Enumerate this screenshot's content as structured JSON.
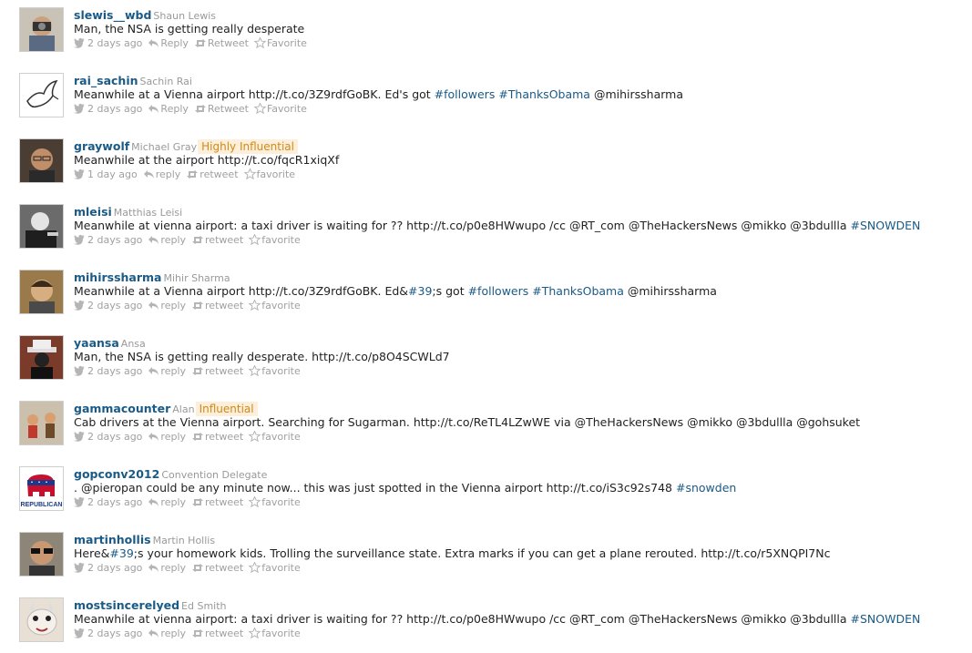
{
  "tweets": [
    {
      "handle": "slewis__wbd",
      "name": "Shaun Lewis",
      "badge": "",
      "parts": [
        {
          "t": "Man, the NSA is getting really desperate",
          "k": "plain"
        }
      ],
      "time": "2 days ago",
      "reply": "Reply",
      "retweet": "Retweet",
      "favorite": "Favorite",
      "avatar": "man-with-camera-avatar"
    },
    {
      "handle": "rai_sachin",
      "name": "Sachin Rai",
      "badge": "",
      "parts": [
        {
          "t": "Meanwhile at a Vienna airport http://t.co/3Z9rdfGoBK. Ed's got ",
          "k": "plain"
        },
        {
          "t": "#followers",
          "k": "hashtag"
        },
        {
          "t": " ",
          "k": "plain"
        },
        {
          "t": "#ThanksObama",
          "k": "hashtag"
        },
        {
          "t": " @mihirssharma",
          "k": "plain"
        }
      ],
      "time": "2 days ago",
      "reply": "Reply",
      "retweet": "Retweet",
      "favorite": "Favorite",
      "avatar": "dove-avatar"
    },
    {
      "handle": "graywolf",
      "name": "Michael Gray",
      "badge": "Highly Influential",
      "parts": [
        {
          "t": "Meanwhile at the airport http://t.co/fqcR1xiqXf",
          "k": "plain"
        }
      ],
      "time": "1 day ago",
      "reply": "reply",
      "retweet": "retweet",
      "favorite": "favorite",
      "avatar": "man-with-glasses-avatar"
    },
    {
      "handle": "mleisi",
      "name": "Matthias Leisi",
      "badge": "",
      "parts": [
        {
          "t": "Meanwhile at vienna airport: a taxi driver is waiting for ?? http://t.co/p0e8HWwupo /cc @RT_com @TheHackersNews @mikko @3bdullla ",
          "k": "plain"
        },
        {
          "t": "#SNOWDEN",
          "k": "hashtag"
        }
      ],
      "time": "2 days ago",
      "reply": "reply",
      "retweet": "retweet",
      "favorite": "favorite",
      "avatar": "bw-portrait-avatar"
    },
    {
      "handle": "mihirssharma",
      "name": "Mihir Sharma",
      "badge": "",
      "parts": [
        {
          "t": "Meanwhile at a Vienna airport http://t.co/3Z9rdfGoBK. Ed&",
          "k": "plain"
        },
        {
          "t": "#39",
          "k": "hashtag"
        },
        {
          "t": ";s got ",
          "k": "plain"
        },
        {
          "t": "#followers",
          "k": "hashtag"
        },
        {
          "t": " ",
          "k": "plain"
        },
        {
          "t": "#ThanksObama",
          "k": "hashtag"
        },
        {
          "t": " @mihirssharma",
          "k": "plain"
        }
      ],
      "time": "2 days ago",
      "reply": "reply",
      "retweet": "retweet",
      "favorite": "favorite",
      "avatar": "man-portrait-avatar"
    },
    {
      "handle": "yaansa",
      "name": "Ansa",
      "badge": "",
      "parts": [
        {
          "t": "Man, the NSA is getting really desperate. http://t.co/p8O4SCWLd7",
          "k": "plain"
        }
      ],
      "time": "2 days ago",
      "reply": "reply",
      "retweet": "retweet",
      "favorite": "favorite",
      "avatar": "hat-figure-avatar"
    },
    {
      "handle": "gammacounter",
      "name": "Alan",
      "badge": "Influential",
      "parts": [
        {
          "t": "Cab drivers at the Vienna airport. Searching for Sugarman. http://t.co/ReTL4LZwWE via @TheHackersNews @mikko @3bdullla @gohsuket",
          "k": "plain"
        }
      ],
      "time": "2 days ago",
      "reply": "reply",
      "retweet": "retweet",
      "favorite": "favorite",
      "avatar": "toy-figures-avatar"
    },
    {
      "handle": "gopconv2012",
      "name": "Convention Delegate",
      "badge": "",
      "parts": [
        {
          "t": ". @pieropan could be any minute now... this was just spotted in the Vienna airport http://t.co/iS3c92s748 ",
          "k": "plain"
        },
        {
          "t": "#snowden",
          "k": "hashtag"
        }
      ],
      "time": "2 days ago",
      "reply": "reply",
      "retweet": "retweet",
      "favorite": "favorite",
      "avatar": "republican-elephant-avatar",
      "avatar_text": "REPUBLICAN"
    },
    {
      "handle": "martinhollis",
      "name": "Martin Hollis",
      "badge": "",
      "parts": [
        {
          "t": "Here&",
          "k": "plain"
        },
        {
          "t": "#39",
          "k": "hashtag"
        },
        {
          "t": ";s your homework kids. Trolling the surveillance state. Extra marks if you can get a plane rerouted. http://t.co/r5XNQPI7Nc",
          "k": "plain"
        }
      ],
      "time": "2 days ago",
      "reply": "reply",
      "retweet": "retweet",
      "favorite": "favorite",
      "avatar": "man-sunglasses-avatar"
    },
    {
      "handle": "mostsincerelyed",
      "name": "Ed Smith",
      "badge": "",
      "parts": [
        {
          "t": "Meanwhile at vienna airport: a taxi driver is waiting for ?? http://t.co/p0e8HWwupo /cc @RT_com @TheHackersNews @mikko @3bdullla ",
          "k": "plain"
        },
        {
          "t": "#SNOWDEN",
          "k": "hashtag"
        }
      ],
      "time": "2 days ago",
      "reply": "reply",
      "retweet": "retweet",
      "favorite": "favorite",
      "avatar": "llama-avatar"
    }
  ],
  "colors": {
    "handle": "#1a5a86",
    "hashtag": "#1a5a86",
    "meta": "#a0a0a0",
    "badge_text": "#d08a1c",
    "badge_bg": "#fdefd9"
  }
}
